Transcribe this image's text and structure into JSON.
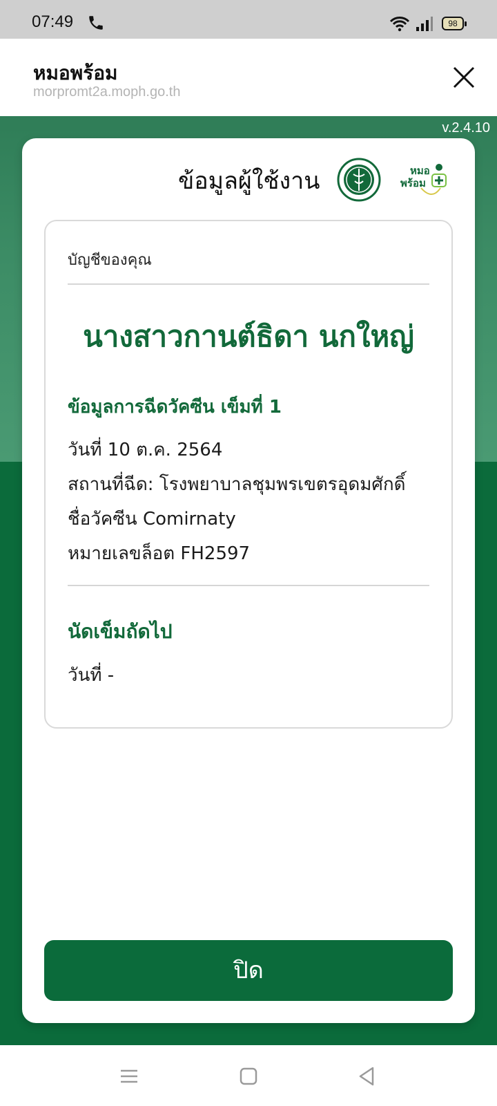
{
  "status_bar": {
    "time": "07:49",
    "battery": "98"
  },
  "browser": {
    "title": "หมอพร้อม",
    "url": "morpromt2a.moph.go.th"
  },
  "version": "v.2.4.10",
  "modal": {
    "title": "ข้อมูลผู้ใช้งาน",
    "account_label": "บัญชีของคุณ",
    "user_name": "นางสาวกานต์ธิดา นกใหญ่",
    "dose_heading": "ข้อมูลการฉีดวัคซีน เข็มที่ 1",
    "details": {
      "date": "วันที่ 10 ต.ค. 2564",
      "place": "สถานที่ฉีด: โรงพยาบาลชุมพรเขตรอุดมศักดิ์",
      "vaccine": "ชื่อวัคซีน Comirnaty",
      "lot": "หมายเลขล็อต FH2597"
    },
    "next_heading": "นัดเข็มถัดไป",
    "next_date": "วันที่ -",
    "close_button": "ปิด"
  },
  "logos": {
    "morprom_line1": "หมอ",
    "morprom_line2": "พร้อม"
  },
  "icons": {
    "phone": "phone-icon",
    "wifi": "wifi-icon",
    "signal": "signal-icon",
    "close": "close-icon",
    "menu": "menu-icon",
    "home": "home-icon",
    "back": "back-icon"
  },
  "colors": {
    "brand_green": "#12693a",
    "button_green": "#0b6b3b"
  }
}
